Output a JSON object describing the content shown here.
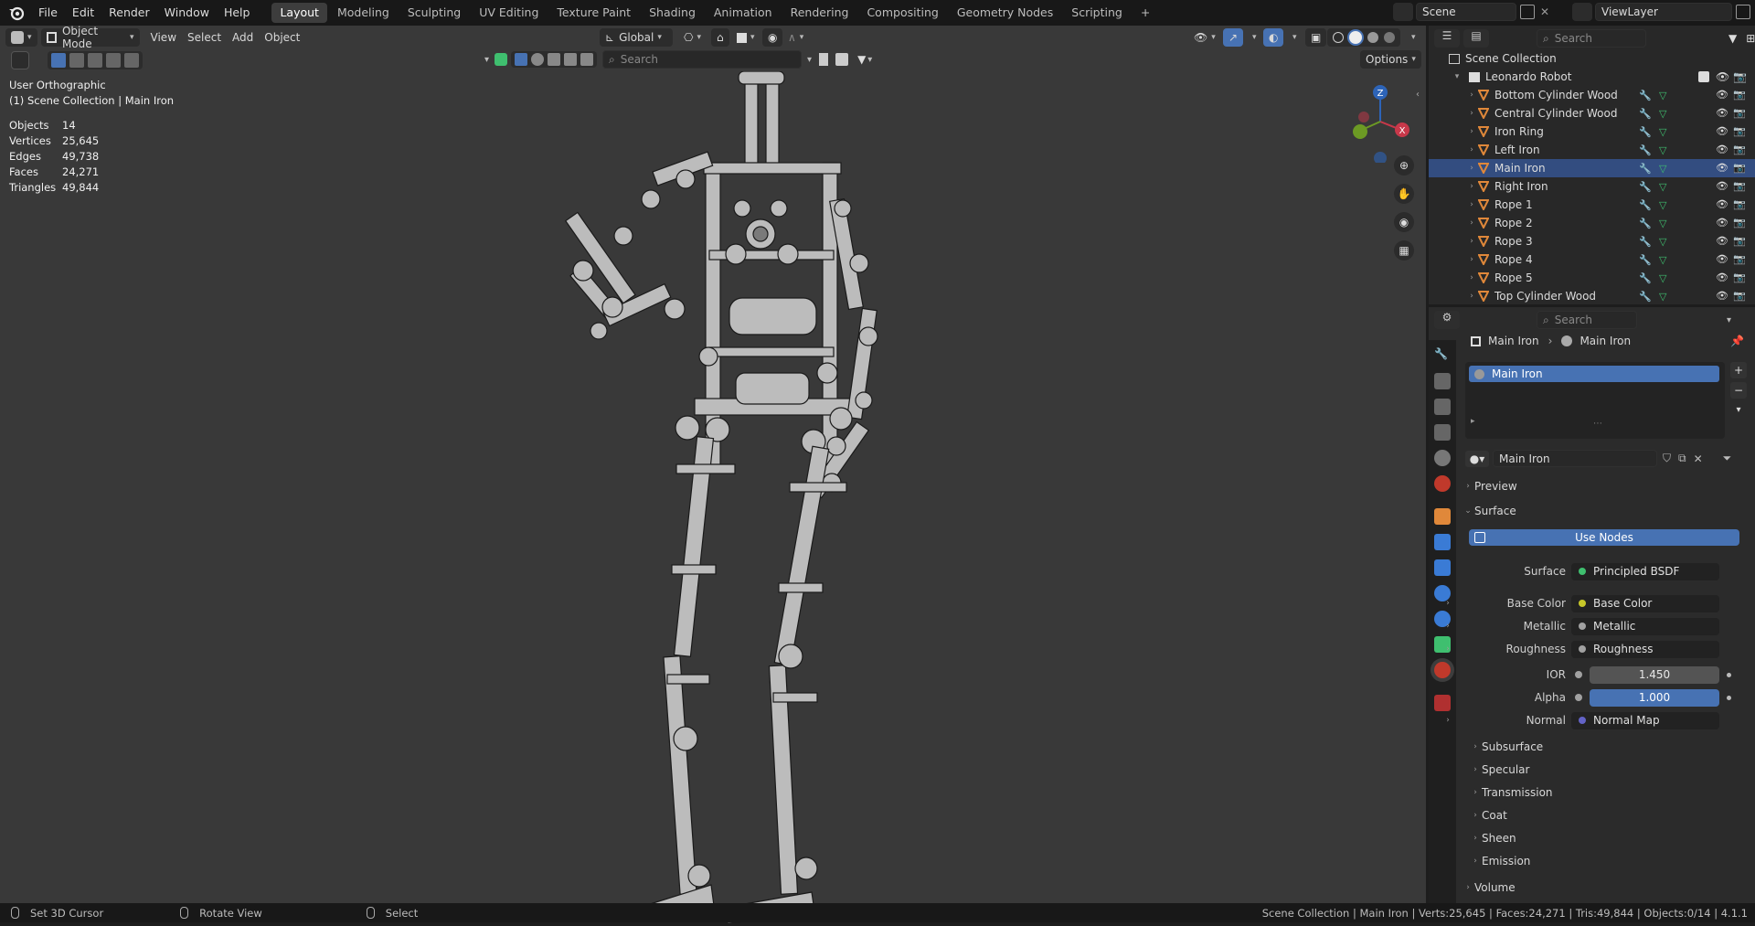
{
  "menu": [
    "File",
    "Edit",
    "Render",
    "Window",
    "Help"
  ],
  "workspaces": [
    {
      "label": "Layout",
      "active": true
    },
    {
      "label": "Modeling"
    },
    {
      "label": "Sculpting"
    },
    {
      "label": "UV Editing"
    },
    {
      "label": "Texture Paint"
    },
    {
      "label": "Shading"
    },
    {
      "label": "Animation"
    },
    {
      "label": "Rendering"
    },
    {
      "label": "Compositing"
    },
    {
      "label": "Geometry Nodes"
    },
    {
      "label": "Scripting"
    }
  ],
  "top_right": {
    "scene": "Scene",
    "view_layer": "ViewLayer"
  },
  "viewport_header": {
    "mode": "Object Mode",
    "menus": [
      "View",
      "Select",
      "Add",
      "Object"
    ],
    "orientation": "Global",
    "search_placeholder": "Search",
    "options": "Options"
  },
  "viewport": {
    "view_name": "User Orthographic",
    "collection_line": "(1) Scene Collection | Main Iron",
    "stats": [
      {
        "k": "Objects",
        "v": "14"
      },
      {
        "k": "Vertices",
        "v": "25,645"
      },
      {
        "k": "Edges",
        "v": "49,738"
      },
      {
        "k": "Faces",
        "v": "24,271"
      },
      {
        "k": "Triangles",
        "v": "49,844"
      }
    ],
    "gizmo": {
      "z": "Z",
      "x": "X"
    }
  },
  "outliner": {
    "search_placeholder": "Search",
    "root": "Scene Collection",
    "collection": "Leonardo Robot",
    "items": [
      {
        "name": "Bottom Cylinder Wood",
        "selected": false
      },
      {
        "name": "Central Cylinder Wood",
        "selected": false
      },
      {
        "name": "Iron Ring",
        "selected": false
      },
      {
        "name": "Left Iron",
        "selected": false
      },
      {
        "name": "Main Iron",
        "selected": true
      },
      {
        "name": "Right Iron",
        "selected": false
      },
      {
        "name": "Rope 1",
        "selected": false
      },
      {
        "name": "Rope 2",
        "selected": false
      },
      {
        "name": "Rope 3",
        "selected": false
      },
      {
        "name": "Rope 4",
        "selected": false
      },
      {
        "name": "Rope 5",
        "selected": false
      },
      {
        "name": "Top Cylinder Wood",
        "selected": false
      }
    ]
  },
  "properties": {
    "search_placeholder": "Search",
    "breadcrumb": [
      "Main Iron",
      "Main Iron"
    ],
    "material_slot": "Main Iron",
    "material_name": "Main Iron",
    "preview": "Preview",
    "surface_section": "Surface",
    "use_nodes": "Use Nodes",
    "surface": {
      "label": "Surface",
      "value": "Principled BSDF"
    },
    "inputs": [
      {
        "label": "Base Color",
        "value": "Base Color",
        "dot": "#c7c729"
      },
      {
        "label": "Metallic",
        "value": "Metallic",
        "dot": "#a1a1a1"
      },
      {
        "label": "Roughness",
        "value": "Roughness",
        "dot": "#a1a1a1"
      }
    ],
    "ior": {
      "label": "IOR",
      "value": "1.450"
    },
    "alpha": {
      "label": "Alpha",
      "value": "1.000"
    },
    "normal": {
      "label": "Normal",
      "value": "Normal Map",
      "dot": "#6363c7"
    },
    "subsections": [
      "Subsurface",
      "Specular",
      "Transmission",
      "Coat",
      "Sheen",
      "Emission"
    ],
    "volume": "Volume"
  },
  "statusbar": {
    "left": [
      {
        "label": "Set 3D Cursor"
      },
      {
        "label": "Rotate View"
      },
      {
        "label": "Select"
      }
    ],
    "right": "Scene Collection | Main Iron | Verts:25,645 | Faces:24,271 | Tris:49,844 | Objects:0/14 | 4.1.1"
  },
  "colors": {
    "accent": "#4772b3",
    "selected_row": "#334d80",
    "object_orange": "#e0883a",
    "mesh_green": "#3fbf6f"
  }
}
